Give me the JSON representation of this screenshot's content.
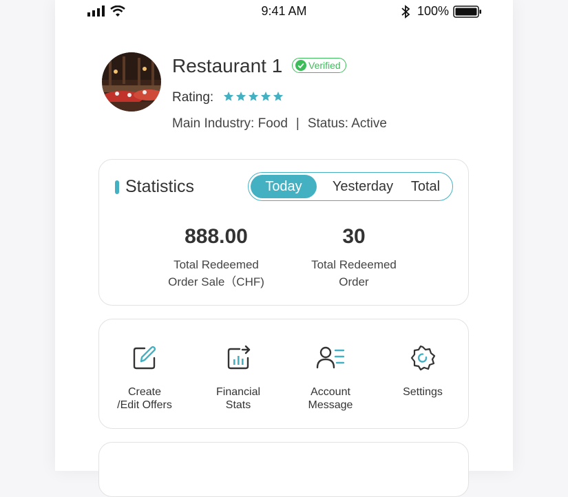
{
  "status_bar": {
    "time": "9:41 AM",
    "battery_percent": "100%"
  },
  "profile": {
    "name": "Restaurant 1",
    "verified_label": "Verified",
    "rating_label": "Rating:",
    "rating_value": 5,
    "rating_max": 5,
    "industry": "Main Industry: Food",
    "separator": "|",
    "status": "Status: Active"
  },
  "statistics": {
    "title": "Statistics",
    "tabs": [
      {
        "label": "Today",
        "active": true
      },
      {
        "label": "Yesterday",
        "active": false
      },
      {
        "label": "Total",
        "active": false
      }
    ],
    "items": [
      {
        "value": "888.00",
        "label": "Total Redeemed\nOrder Sale（CHF)"
      },
      {
        "value": "30",
        "label": "Total Redeemed\nOrder"
      }
    ]
  },
  "actions": [
    {
      "label": "Create\n/Edit Offers",
      "icon": "edit-icon"
    },
    {
      "label": "Financial\nStats",
      "icon": "stats-icon"
    },
    {
      "label": "Account\nMessage",
      "icon": "account-message-icon"
    },
    {
      "label": "Settings",
      "icon": "gear-icon"
    }
  ],
  "colors": {
    "accent": "#44b1c2",
    "verified": "#3dbd5a"
  }
}
